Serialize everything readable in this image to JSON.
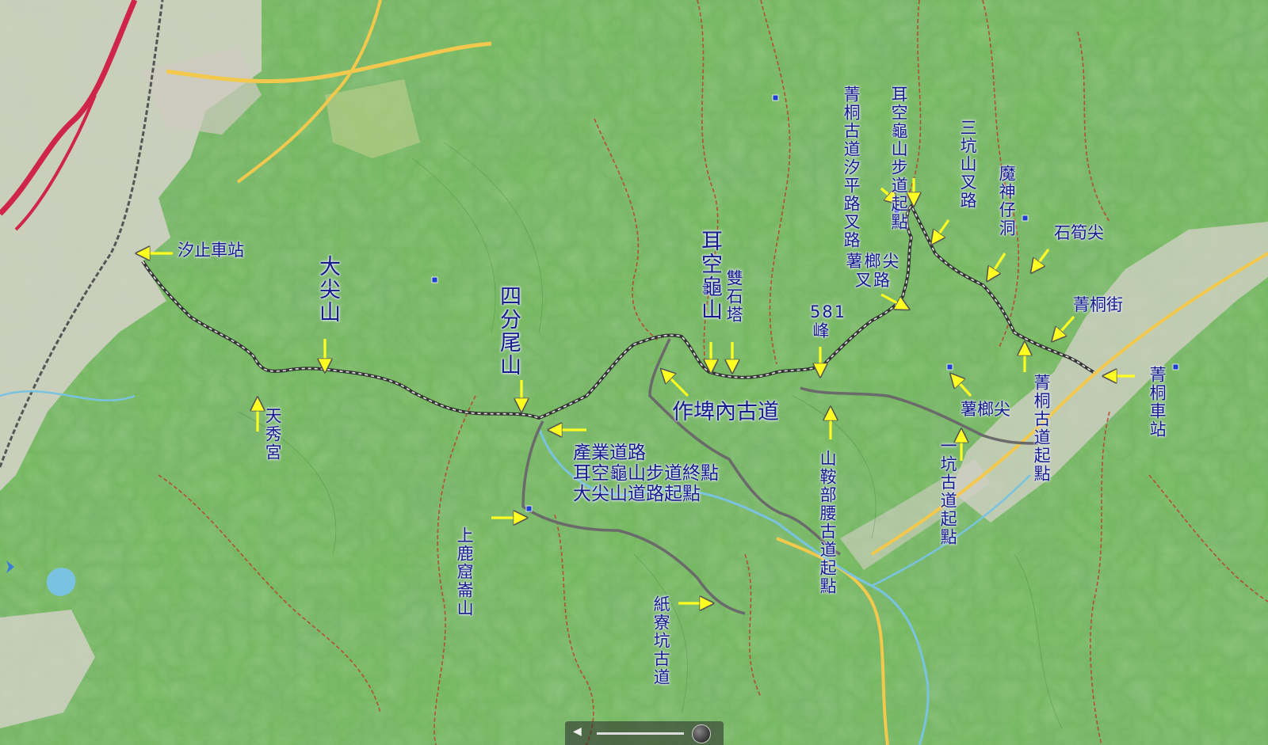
{
  "colors": {
    "terrain": "#74b85e",
    "terrain_dark": "#3d7a34",
    "urban": "#d8d4cc",
    "route": "#555555",
    "trail": "#c0392b",
    "arrow": "#ffff22",
    "label": "#141c8c"
  },
  "labels": {
    "xizhi_station": "汐止車站",
    "tianxiu_temple": "天秀宮",
    "dajianshan": "大尖山",
    "sifenweishan": "四分尾山",
    "industrial_road": "產業道路",
    "erkongui_end": "耳空龜山步道終點",
    "dajianshan_start": "大尖山道路起點",
    "shanglu_peak": "上鹿窟崙山",
    "erkongui_shan": "耳空龜山",
    "shuangshi_ta": "雙石塔",
    "zuopinei": "作埤內古道",
    "peak581": "581峰",
    "zhiliaokeng": "紙寮坑古道",
    "shanbu_start": "山鞍部腰古道起點",
    "shujiaojian_fork": "薯榔尖叉路",
    "xiping_fork": "菁桐古道汐平路叉路",
    "erkongui_trail_start": "耳空龜山步道起點",
    "sankeng_fork": "三坑山叉路",
    "moshen_cave": "魔神仔洞",
    "shisunjian": "石筍尖",
    "jingtong_street": "菁桐街",
    "jingtong_station": "菁桐車站",
    "jingtong_trail_start": "菁桐古道起點",
    "shujiaojian": "薯榔尖",
    "yikeng_start": "一坑古道起點"
  },
  "icons": {
    "arrow": "arrow-icon",
    "trail_marker": "trailhead-marker-icon",
    "back": "back-icon",
    "compass": "compass-icon"
  }
}
